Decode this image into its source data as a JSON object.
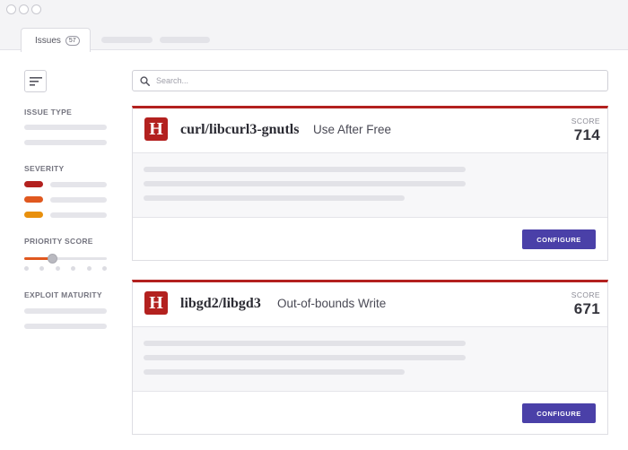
{
  "window": {
    "tabs": [
      {
        "label": "Issues",
        "badge": "57"
      }
    ]
  },
  "sidebar": {
    "filters": [
      {
        "label": "ISSUE TYPE"
      },
      {
        "label": "SEVERITY",
        "colors": [
          "#b3211f",
          "#e0581f",
          "#e8900d"
        ]
      },
      {
        "label": "PRIORITY SCORE"
      },
      {
        "label": "EXPLOIT MATURITY"
      }
    ]
  },
  "search": {
    "placeholder": "Search..."
  },
  "issues": [
    {
      "severity_letter": "H",
      "severity_color": "#b3211f",
      "package": "curl/libcurl3-gnutls",
      "vulnerability": "Use After Free",
      "score_label": "SCORE",
      "score": "714",
      "action_label": "CONFIGURE"
    },
    {
      "severity_letter": "H",
      "severity_color": "#b3211f",
      "package": "libgd2/libgd3",
      "vulnerability": "Out-of-bounds Write",
      "score_label": "SCORE",
      "score": "671",
      "action_label": "CONFIGURE"
    }
  ],
  "colors": {
    "accent": "#4a40a8",
    "high_severity": "#b3211f"
  }
}
